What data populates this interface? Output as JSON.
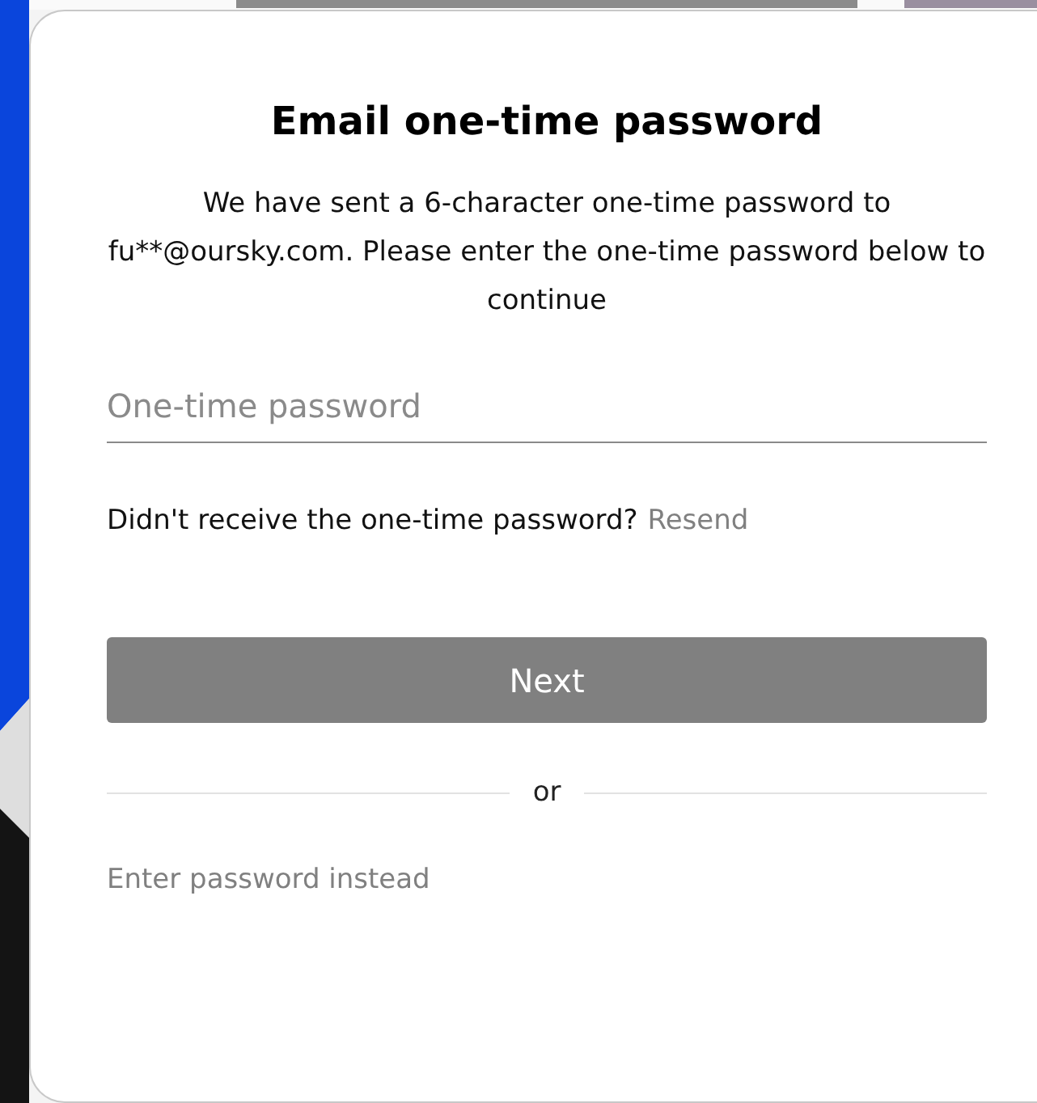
{
  "title": "Email one-time password",
  "description": "We have sent a 6-character one-time password to fu**@oursky.com. Please enter the one-time password below to continue",
  "otp_field": {
    "placeholder": "One-time password"
  },
  "resend": {
    "prompt": "Didn't receive the one-time password?",
    "link": "Resend"
  },
  "next_button": {
    "label": "Next",
    "disabled": true
  },
  "divider": "or",
  "alternative_link": "Enter password instead"
}
